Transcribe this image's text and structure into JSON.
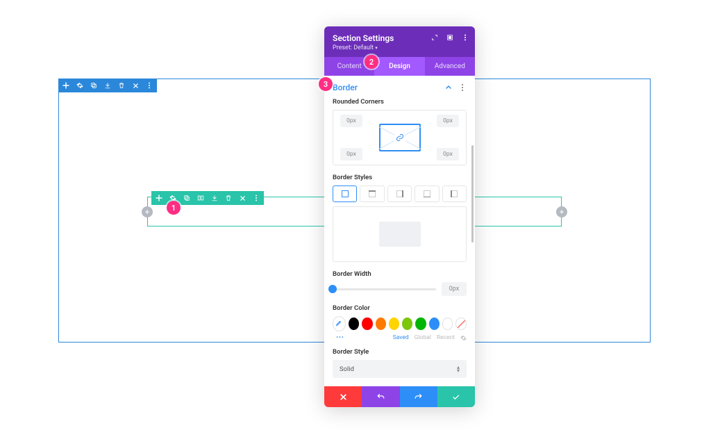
{
  "section_toolbar": {
    "items": [
      "add",
      "settings",
      "duplicate",
      "color",
      "save",
      "delete",
      "more"
    ]
  },
  "row_toolbar": {
    "items": [
      "add",
      "settings",
      "duplicate",
      "columns",
      "color",
      "save",
      "delete",
      "more"
    ]
  },
  "steps": {
    "one": "1",
    "two": "2",
    "three": "3"
  },
  "panel": {
    "title": "Section Settings",
    "preset": "Preset: Default",
    "tabs": {
      "content": "Content",
      "design": "Design",
      "advanced": "Advanced"
    },
    "section": {
      "title": "Border",
      "rounded_label": "Rounded Corners",
      "corners": {
        "tl": "0px",
        "tr": "0px",
        "bl": "0px",
        "br": "0px"
      },
      "border_styles_label": "Border Styles",
      "border_width_label": "Border Width",
      "border_width_value": "0px",
      "border_color_label": "Border Color",
      "swatch_tabs": {
        "saved": "Saved",
        "global": "Global",
        "recent": "Recent"
      },
      "colors": [
        "#000000",
        "#ff0000",
        "#ff7a00",
        "#ffd400",
        "#7ac70c",
        "#00b506",
        "#2e8ef7"
      ],
      "border_style_label": "Border Style",
      "border_style_value": "Solid"
    }
  }
}
